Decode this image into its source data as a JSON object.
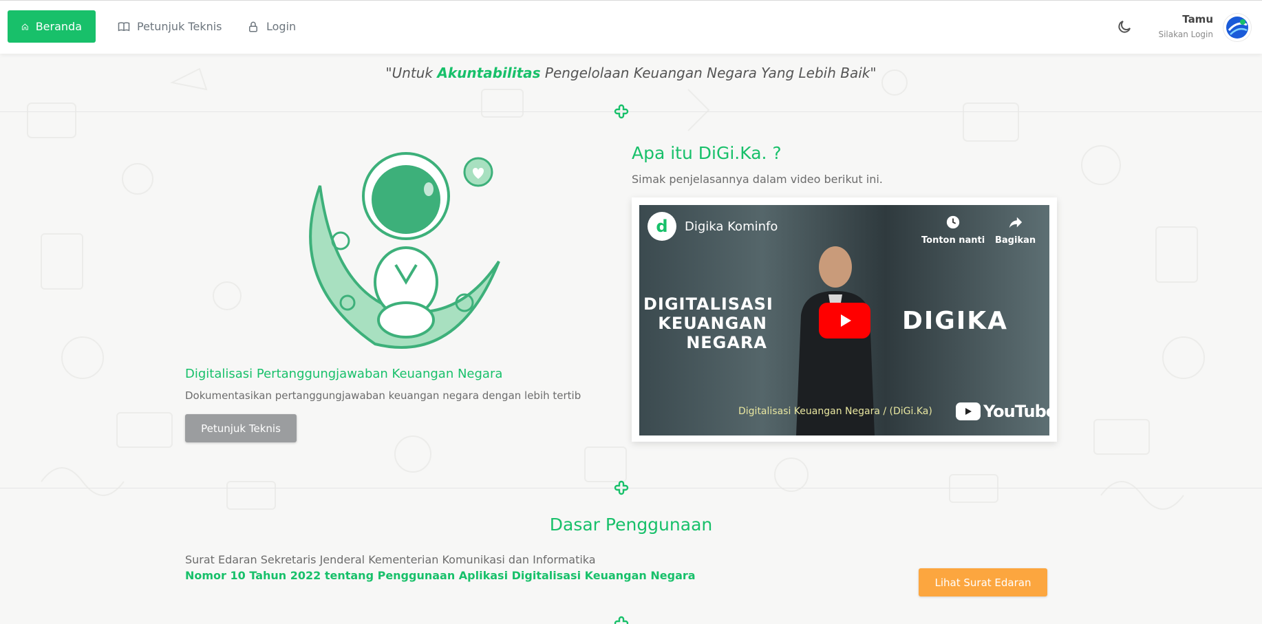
{
  "nav": {
    "items": [
      {
        "label": "Beranda",
        "icon": "home-icon"
      },
      {
        "label": "Petunjuk Teknis",
        "icon": "book-icon"
      },
      {
        "label": "Login",
        "icon": "lock-icon"
      }
    ],
    "user_name": "Tamu",
    "user_sub": "Silakan Login"
  },
  "hero": {
    "tagline_open": "\"Untuk ",
    "tagline_highlight": "Akuntabilitas",
    "tagline_rest": " Pengelolaan Keuangan Negara Yang Lebih Baik\"",
    "left_title": "Digitalisasi Pertanggungjawaban Keuangan Negara",
    "left_desc": "Dokumentasikan pertanggungjawaban keuangan negara dengan lebih tertib",
    "left_button": "Petunjuk Teknis",
    "right_title": "Apa itu DiGi.Ka. ?",
    "right_desc": "Simak penjelasannya dalam video berikut ini."
  },
  "video": {
    "channel_logo_letter": "d",
    "channel_name": "Digika Kominfo",
    "watch_later": "Tonton nanti",
    "share": "Bagikan",
    "overlay_left": [
      "DIGITALISASI",
      "KEUANGAN",
      "NEGARA"
    ],
    "overlay_right": "DIGIKA",
    "caption": "Digitalisasi Keuangan Negara / (DiGi.Ka)",
    "youtube_text": "YouTube"
  },
  "dasar": {
    "title": "Dasar Penggunaan",
    "line1": "Surat Edaran Sekretaris Jenderal Kementerian Komunikasi dan Informatika",
    "line2": "Nomor 10 Tahun 2022 tentang Penggunaan Aplikasi Digitalisasi Keuangan Negara",
    "button": "Lihat Surat Edaran"
  },
  "colors": {
    "accent": "#18c06a",
    "orange": "#fca63f",
    "grey_button": "#9b9d9f"
  }
}
